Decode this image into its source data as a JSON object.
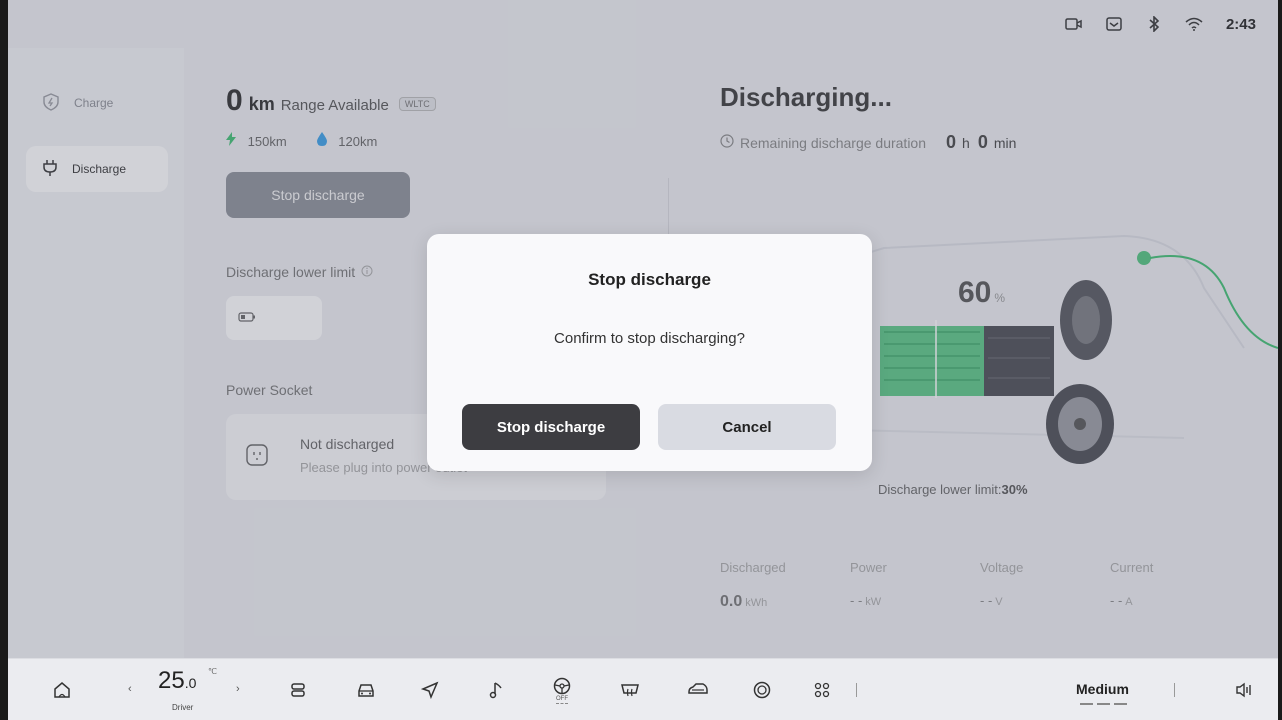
{
  "status_bar": {
    "time": "2:43",
    "icons": [
      "camera-icon",
      "message-icon",
      "bluetooth-icon",
      "wifi-icon"
    ]
  },
  "sidebar": {
    "items": [
      {
        "label": "Charge",
        "icon": "charge-shield-icon",
        "active": false
      },
      {
        "label": "Discharge",
        "icon": "plug-icon",
        "active": true
      }
    ]
  },
  "left_panel": {
    "range_value": "0",
    "range_unit": "km",
    "range_label": "Range Available",
    "range_badge": "WLTC",
    "electric_range": "150km",
    "fuel_range": "120km",
    "stop_button_label": "Stop discharge",
    "lower_limit_label": "Discharge lower limit",
    "power_socket_label": "Power Socket",
    "socket_status": "Not discharged",
    "socket_hint": "Please plug into power outlet"
  },
  "right_panel": {
    "title": "Discharging...",
    "remaining_label": "Remaining discharge duration",
    "remaining_hours": "0",
    "remaining_hours_unit": "h",
    "remaining_minutes": "0",
    "remaining_minutes_unit": "min",
    "battery_percent": "60",
    "battery_percent_unit": "%",
    "lower_limit_note_label": "Discharge lower limit:",
    "lower_limit_note_value": "30%",
    "stats": [
      {
        "label": "Discharged",
        "value": "0.0",
        "unit": "kWh"
      },
      {
        "label": "Power",
        "value": "- -",
        "unit": "kW"
      },
      {
        "label": "Voltage",
        "value": "- -",
        "unit": "V"
      },
      {
        "label": "Current",
        "value": "- -",
        "unit": "A"
      }
    ]
  },
  "modal": {
    "title": "Stop discharge",
    "message": "Confirm to stop discharging?",
    "confirm_label": "Stop discharge",
    "cancel_label": "Cancel"
  },
  "bottom_bar": {
    "temperature": "25",
    "temperature_decimal": ".0",
    "temperature_unit": "℃",
    "temperature_zone": "Driver",
    "fan_level": "Medium",
    "defrost_label": "OFF",
    "icons": [
      "home-icon",
      "seat-icon",
      "car-icon",
      "navigation-icon",
      "music-icon",
      "steering-wheel-heat-icon",
      "rear-defrost-icon",
      "car-side-icon",
      "target-icon",
      "apps-icon",
      "volume-icon"
    ]
  },
  "colors": {
    "accent_green": "#3fbf72",
    "fuel_blue": "#3aa0e8",
    "dark_button": "#3d3d41",
    "light_button": "#d9dbe2"
  }
}
